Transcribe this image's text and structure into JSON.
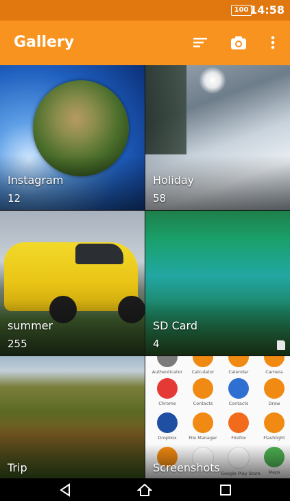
{
  "status": {
    "battery": "100",
    "time": "14:58"
  },
  "appbar": {
    "title": "Gallery",
    "icons": [
      "sort-icon",
      "camera-icon",
      "more-vert-icon"
    ]
  },
  "albums": [
    {
      "name": "Instagram",
      "count": "12"
    },
    {
      "name": "Holiday",
      "count": "58"
    },
    {
      "name": "summer",
      "count": "255"
    },
    {
      "name": "SD Card",
      "count": "4"
    },
    {
      "name": "Trip",
      "count": ""
    },
    {
      "name": "Screenshots",
      "count": ""
    }
  ],
  "screenshot_apps": [
    {
      "label": "Authenticator",
      "color": "#7b7b7b"
    },
    {
      "label": "Calculator",
      "color": "#f08a12"
    },
    {
      "label": "Calendar",
      "color": "#f08a12"
    },
    {
      "label": "Camera",
      "color": "#f08a12"
    },
    {
      "label": "Chrome",
      "color": "#e53935"
    },
    {
      "label": "Contacts",
      "color": "#f08a12"
    },
    {
      "label": "Contacts",
      "color": "#2f6fd1"
    },
    {
      "label": "Draw",
      "color": "#f08a12"
    },
    {
      "label": "Dropbox",
      "color": "#1e4fa3"
    },
    {
      "label": "File Manager",
      "color": "#f08a12"
    },
    {
      "label": "Firefox",
      "color": "#f26b1d"
    },
    {
      "label": "Flashlight",
      "color": "#f08a12"
    },
    {
      "label": "",
      "color": "#f08a12"
    },
    {
      "label": "",
      "color": "#ffffff"
    },
    {
      "label": "Google Play Store",
      "color": "#ffffff"
    },
    {
      "label": "Maps",
      "color": "#4caf50"
    }
  ],
  "colors": {
    "statusbar": "#e0770f",
    "appbar": "#f7931e",
    "accent": "#f08a12"
  }
}
